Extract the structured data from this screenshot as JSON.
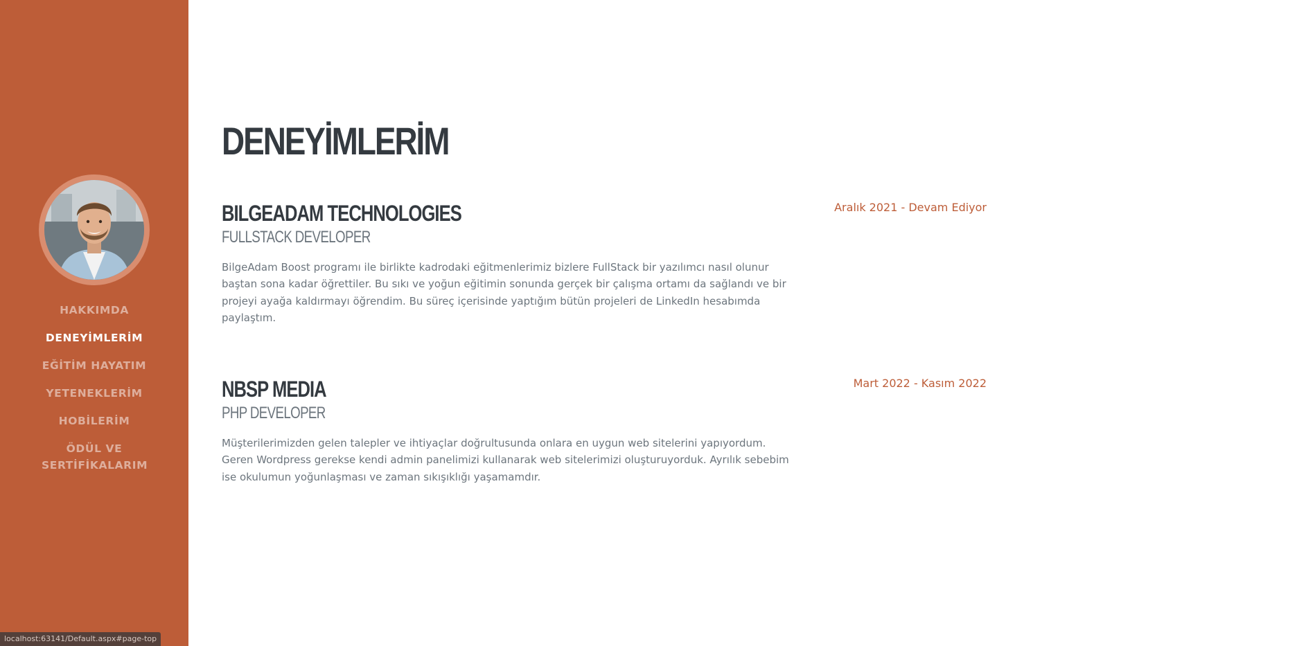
{
  "sidebar": {
    "avatar_alt": "",
    "nav": [
      {
        "label": "HAKKIMDA",
        "active": false
      },
      {
        "label": "DENEYİMLERİM",
        "active": true
      },
      {
        "label": "EĞİTİM HAYATIM",
        "active": false
      },
      {
        "label": "YETENEKLERİM",
        "active": false
      },
      {
        "label": "HOBİLERİM",
        "active": false
      },
      {
        "label": "ÖDÜL VE SERTİFİKALARIM",
        "active": false
      }
    ]
  },
  "main": {
    "title": "DENEYİMLERİM",
    "experiences": [
      {
        "company": "BILGEADAM TECHNOLOGIES",
        "role": "FULLSTACK DEVELOPER",
        "date": "Aralık 2021 - Devam Ediyor",
        "description": "BilgeAdam Boost programı ile birlikte kadrodaki eğitmenlerimiz bizlere FullStack bir yazılımcı nasıl olunur baştan sona kadar öğrettiler. Bu sıkı ve yoğun eğitimin sonunda gerçek bir çalışma ortamı da sağlandı ve bir projeyi ayağa kaldırmayı öğrendim. Bu süreç içerisinde yaptığım bütün projeleri de LinkedIn hesabımda paylaştım."
      },
      {
        "company": "NBSP MEDIA",
        "role": "PHP DEVELOPER",
        "date": "Mart 2022 - Kasım 2022",
        "description": "Müşterilerimizden gelen talepler ve ihtiyaçlar doğrultusunda onlara en uygun web sitelerini yapıyordum. Geren Wordpress gerekse kendi admin panelimizi kullanarak web sitelerimizi oluşturuyorduk. Ayrılık sebebim ise okulumun yoğunlaşması ve zaman sıkışıklığı yaşamamdır."
      }
    ]
  },
  "status_bar": {
    "url": "localhost:63141/Default.aspx#page-top"
  },
  "colors": {
    "sidebar_bg": "#bd5d38",
    "accent": "#bd5d38",
    "heading": "#343a40",
    "muted": "#6c757d"
  }
}
